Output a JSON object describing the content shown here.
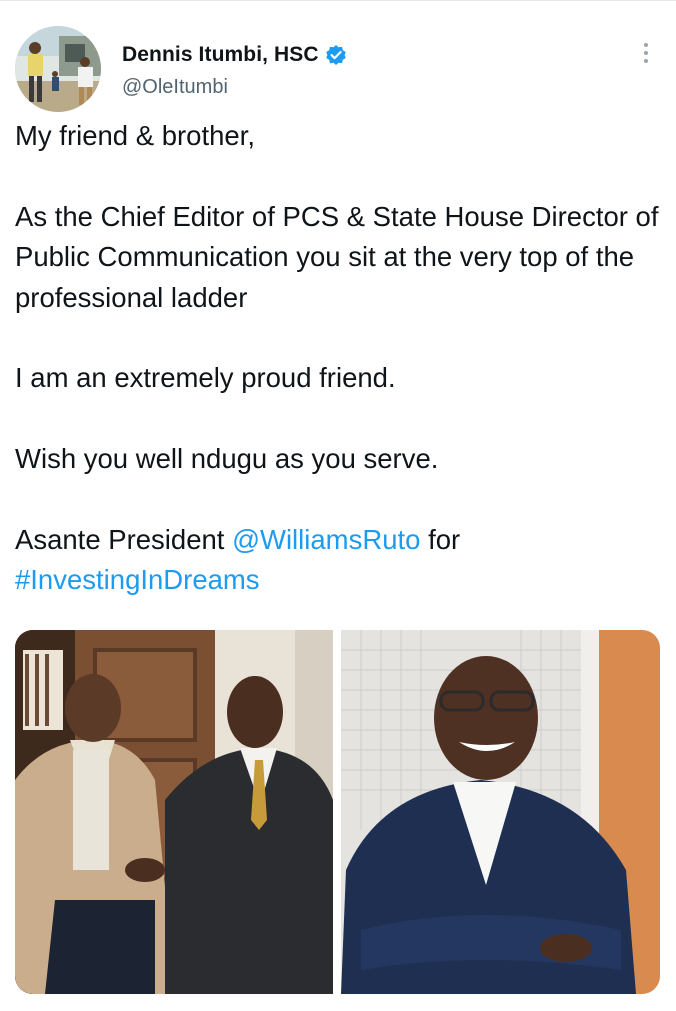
{
  "author": {
    "display_name": "Dennis Itumbi, HSC",
    "handle": "@OleItumbi",
    "verified": true,
    "avatar_icon": "profile-photo-avatar"
  },
  "menu": {
    "icon": "more-vertical-icon"
  },
  "tweet": {
    "p1": "My friend & brother,",
    "p2": "As the Chief Editor of PCS & State House Director of Public Communication you sit at the very top of the professional ladder",
    "p3": "I am an extremely proud friend.",
    "p4": "Wish you well ndugu as you serve.",
    "p5_prefix": "Asante President ",
    "mention": "@WilliamsRuto",
    "p5_mid": " for",
    "hashtag": "#InvestingInDreams"
  },
  "media": {
    "photos": [
      {
        "icon": "handshake-photo"
      },
      {
        "icon": "portrait-photo"
      }
    ]
  },
  "colors": {
    "link": "#1d9bf0",
    "text": "#0f1419",
    "secondary": "#536471",
    "verified_badge": "#1d9bf0"
  }
}
